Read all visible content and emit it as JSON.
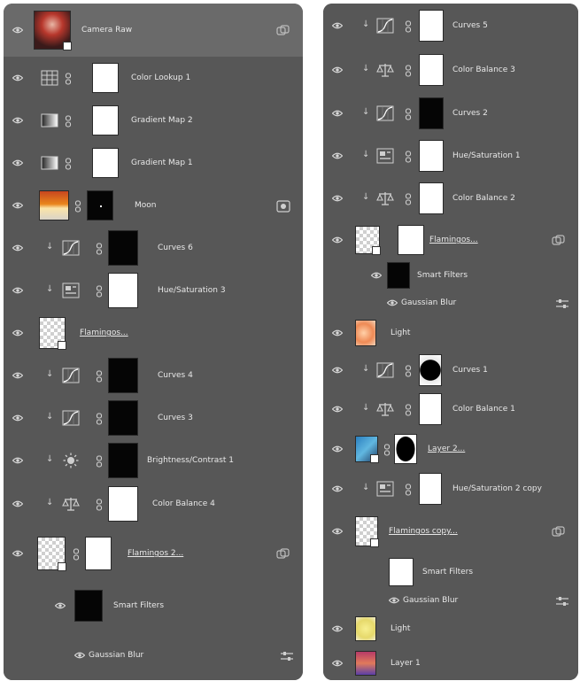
{
  "panels": {
    "left": {
      "layers": [
        {
          "name": "Camera Raw",
          "type": "smart"
        },
        {
          "name": "Color Lookup 1",
          "type": "adjustment",
          "icon": "lookup"
        },
        {
          "name": "Gradient Map 2",
          "type": "adjustment",
          "icon": "gradient"
        },
        {
          "name": "Gradient Map 1",
          "type": "adjustment",
          "icon": "gradient"
        },
        {
          "name": "Moon",
          "type": "pixel"
        },
        {
          "name": "Curves 6",
          "type": "adjustment",
          "icon": "curves"
        },
        {
          "name": "Hue/Saturation 3",
          "type": "adjustment",
          "icon": "hue"
        },
        {
          "name": "Flamingos...",
          "type": "smart"
        },
        {
          "name": "Curves 4",
          "type": "adjustment",
          "icon": "curves"
        },
        {
          "name": "Curves 3",
          "type": "adjustment",
          "icon": "curves"
        },
        {
          "name": "Brightness/Contrast 1",
          "type": "adjustment",
          "icon": "brightness"
        },
        {
          "name": "Color Balance 4",
          "type": "adjustment",
          "icon": "balance"
        },
        {
          "name": "Flamingos 2...",
          "type": "smart"
        },
        {
          "name": "Smart Filters",
          "type": "filters"
        },
        {
          "name": "Gaussian Blur",
          "type": "filter"
        }
      ]
    },
    "right": {
      "layers": [
        {
          "name": "Curves 5",
          "type": "adjustment",
          "icon": "curves"
        },
        {
          "name": "Color Balance 3",
          "type": "adjustment",
          "icon": "balance"
        },
        {
          "name": "Curves 2",
          "type": "adjustment",
          "icon": "curves"
        },
        {
          "name": "Hue/Saturation 1",
          "type": "adjustment",
          "icon": "hue"
        },
        {
          "name": "Color Balance 2",
          "type": "adjustment",
          "icon": "balance"
        },
        {
          "name": "Flamingos...",
          "type": "smart"
        },
        {
          "name": "Smart Filters",
          "type": "filters"
        },
        {
          "name": "Gaussian Blur",
          "type": "filter"
        },
        {
          "name": "Light",
          "type": "pixel"
        },
        {
          "name": "Curves 1",
          "type": "adjustment",
          "icon": "curves"
        },
        {
          "name": "Color Balance 1",
          "type": "adjustment",
          "icon": "balance"
        },
        {
          "name": "Layer 2...",
          "type": "smart"
        },
        {
          "name": "Hue/Saturation 2 copy",
          "type": "adjustment",
          "icon": "hue"
        },
        {
          "name": "Flamingos copy...",
          "type": "smart"
        },
        {
          "name": "Smart Filters",
          "type": "filters"
        },
        {
          "name": "Gaussian Blur",
          "type": "filter"
        },
        {
          "name": "Light",
          "type": "pixel"
        },
        {
          "name": "Layer 1",
          "type": "pixel"
        }
      ]
    }
  },
  "colors": {
    "panel": "#535353",
    "row": "#575757",
    "selected": "#6a6a6a",
    "text": "#e8e8e8"
  }
}
